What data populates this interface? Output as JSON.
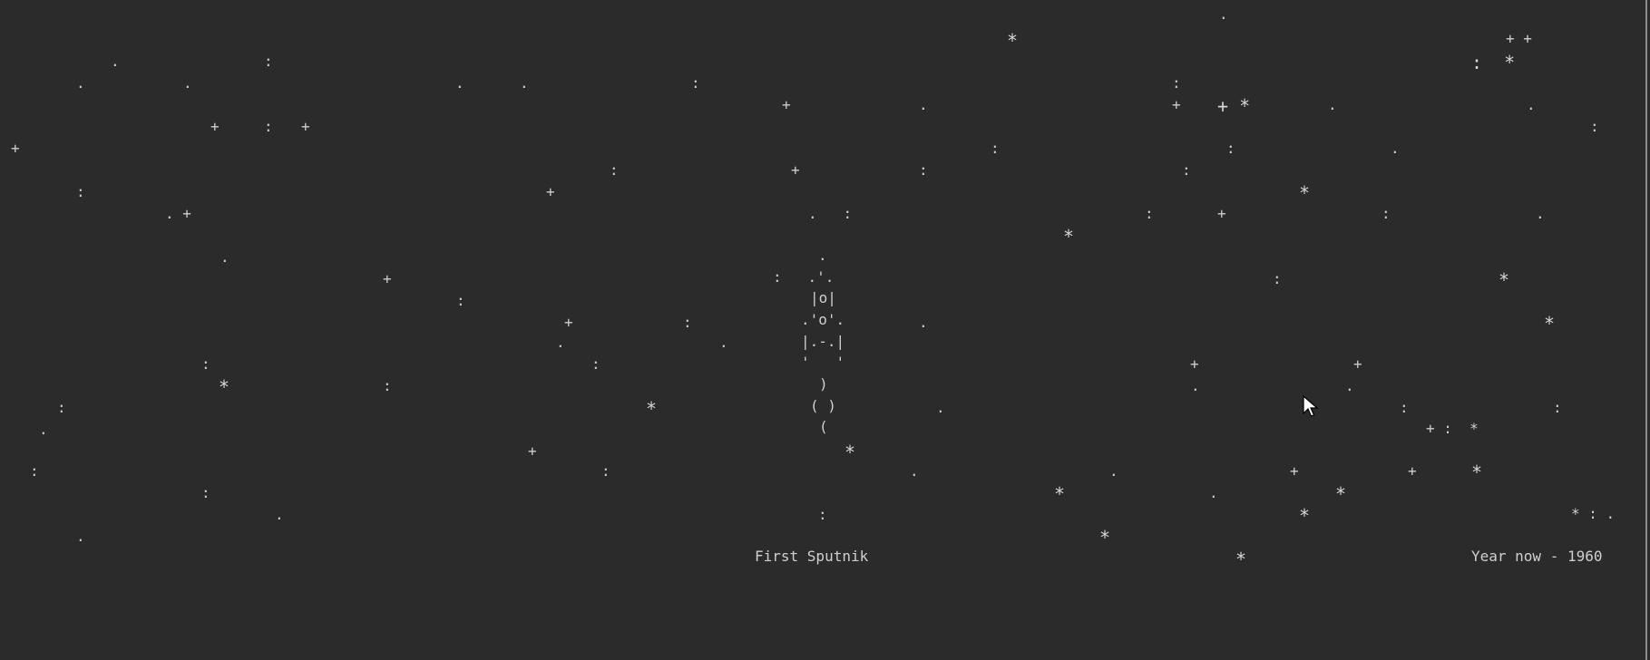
{
  "scene": {
    "caption": "First Sputnik",
    "year_label": "Year now - 1960"
  },
  "rocket": {
    "lines": [
      ".",
      ":   .'.",
      "|o|",
      ".'o'.",
      "|.-.|",
      "'   '",
      ")",
      "( )",
      "("
    ]
  },
  "stars": [
    {
      "s": "."
    },
    {
      "s": "*"
    },
    {
      "s": "+ +"
    },
    {
      "s": "."
    },
    {
      "s": ":"
    },
    {
      "s": ":  *"
    },
    {
      "s": "."
    },
    {
      "s": "."
    },
    {
      "s": "."
    },
    {
      "s": "."
    },
    {
      "s": ":"
    },
    {
      "s": ":"
    },
    {
      "s": "+"
    },
    {
      "s": "."
    },
    {
      "s": "+"
    },
    {
      "s": "+ *"
    },
    {
      "s": "."
    },
    {
      "s": "."
    },
    {
      "s": "+"
    },
    {
      "s": ":"
    },
    {
      "s": "+"
    },
    {
      "s": ":"
    },
    {
      "s": "+"
    },
    {
      "s": ":"
    },
    {
      "s": ":"
    },
    {
      "s": "."
    },
    {
      "s": ":"
    },
    {
      "s": "+"
    },
    {
      "s": ":"
    },
    {
      "s": ":"
    },
    {
      "s": ":"
    },
    {
      "s": "+"
    },
    {
      "s": "*"
    },
    {
      "s": ". +"
    },
    {
      "s": ".   :"
    },
    {
      "s": ":"
    },
    {
      "s": "+"
    },
    {
      "s": ":"
    },
    {
      "s": "."
    },
    {
      "s": "*"
    },
    {
      "s": "."
    },
    {
      "s": "+"
    },
    {
      "s": ":"
    },
    {
      "s": "*"
    },
    {
      "s": ":"
    },
    {
      "s": "+"
    },
    {
      "s": ":"
    },
    {
      "s": "."
    },
    {
      "s": "*"
    },
    {
      "s": "."
    },
    {
      "s": "."
    },
    {
      "s": ":"
    },
    {
      "s": ":"
    },
    {
      "s": "+"
    },
    {
      "s": "+"
    },
    {
      "s": "*"
    },
    {
      "s": ":"
    },
    {
      "s": "."
    },
    {
      "s": "."
    },
    {
      "s": ":"
    },
    {
      "s": "*"
    },
    {
      "s": "."
    },
    {
      "s": ":"
    },
    {
      "s": ":"
    },
    {
      "s": "."
    },
    {
      "s": "+ :  *"
    },
    {
      "s": "+"
    },
    {
      "s": "*"
    },
    {
      "s": ":"
    },
    {
      "s": ":"
    },
    {
      "s": "."
    },
    {
      "s": "."
    },
    {
      "s": "+"
    },
    {
      "s": "+"
    },
    {
      "s": "*"
    },
    {
      "s": ":"
    },
    {
      "s": "*"
    },
    {
      "s": "."
    },
    {
      "s": "*"
    },
    {
      "s": "."
    },
    {
      "s": ":"
    },
    {
      "s": "*"
    },
    {
      "s": "* : ."
    },
    {
      "s": "."
    },
    {
      "s": "*"
    },
    {
      "s": "*"
    }
  ]
}
